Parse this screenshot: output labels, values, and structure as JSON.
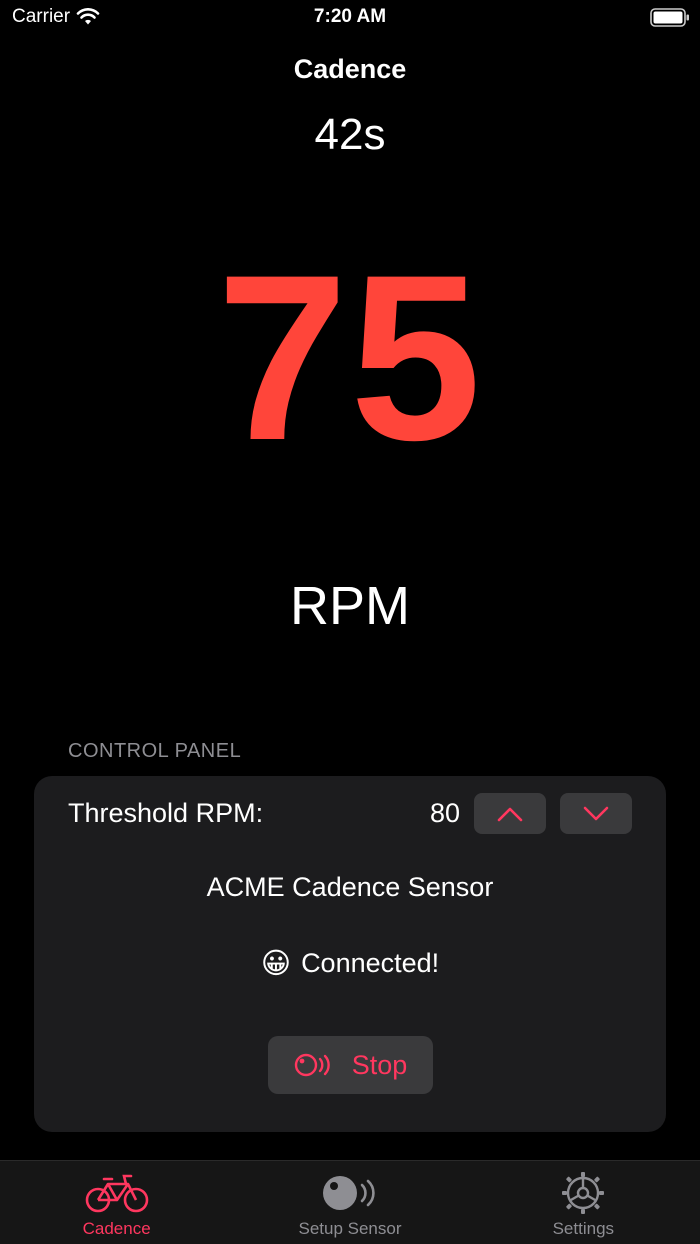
{
  "status_bar": {
    "carrier": "Carrier",
    "time": "7:20 AM"
  },
  "nav": {
    "title": "Cadence"
  },
  "timer": "42s",
  "cadence": {
    "value": "75",
    "unit": "RPM",
    "value_color": "#ff453a"
  },
  "control_panel": {
    "header": "CONTROL PANEL",
    "threshold_label": "Threshold RPM:",
    "threshold_value": "80",
    "sensor_name": "ACME Cadence Sensor",
    "status_emoji": "😀",
    "status_text": "Connected!",
    "stop_label": "Stop",
    "accent_color": "#ff375f"
  },
  "tabs": [
    {
      "label": "Cadence",
      "icon": "bicycle-icon",
      "active": true
    },
    {
      "label": "Setup Sensor",
      "icon": "sensor-icon",
      "active": false
    },
    {
      "label": "Settings",
      "icon": "gear-icon",
      "active": false
    }
  ]
}
